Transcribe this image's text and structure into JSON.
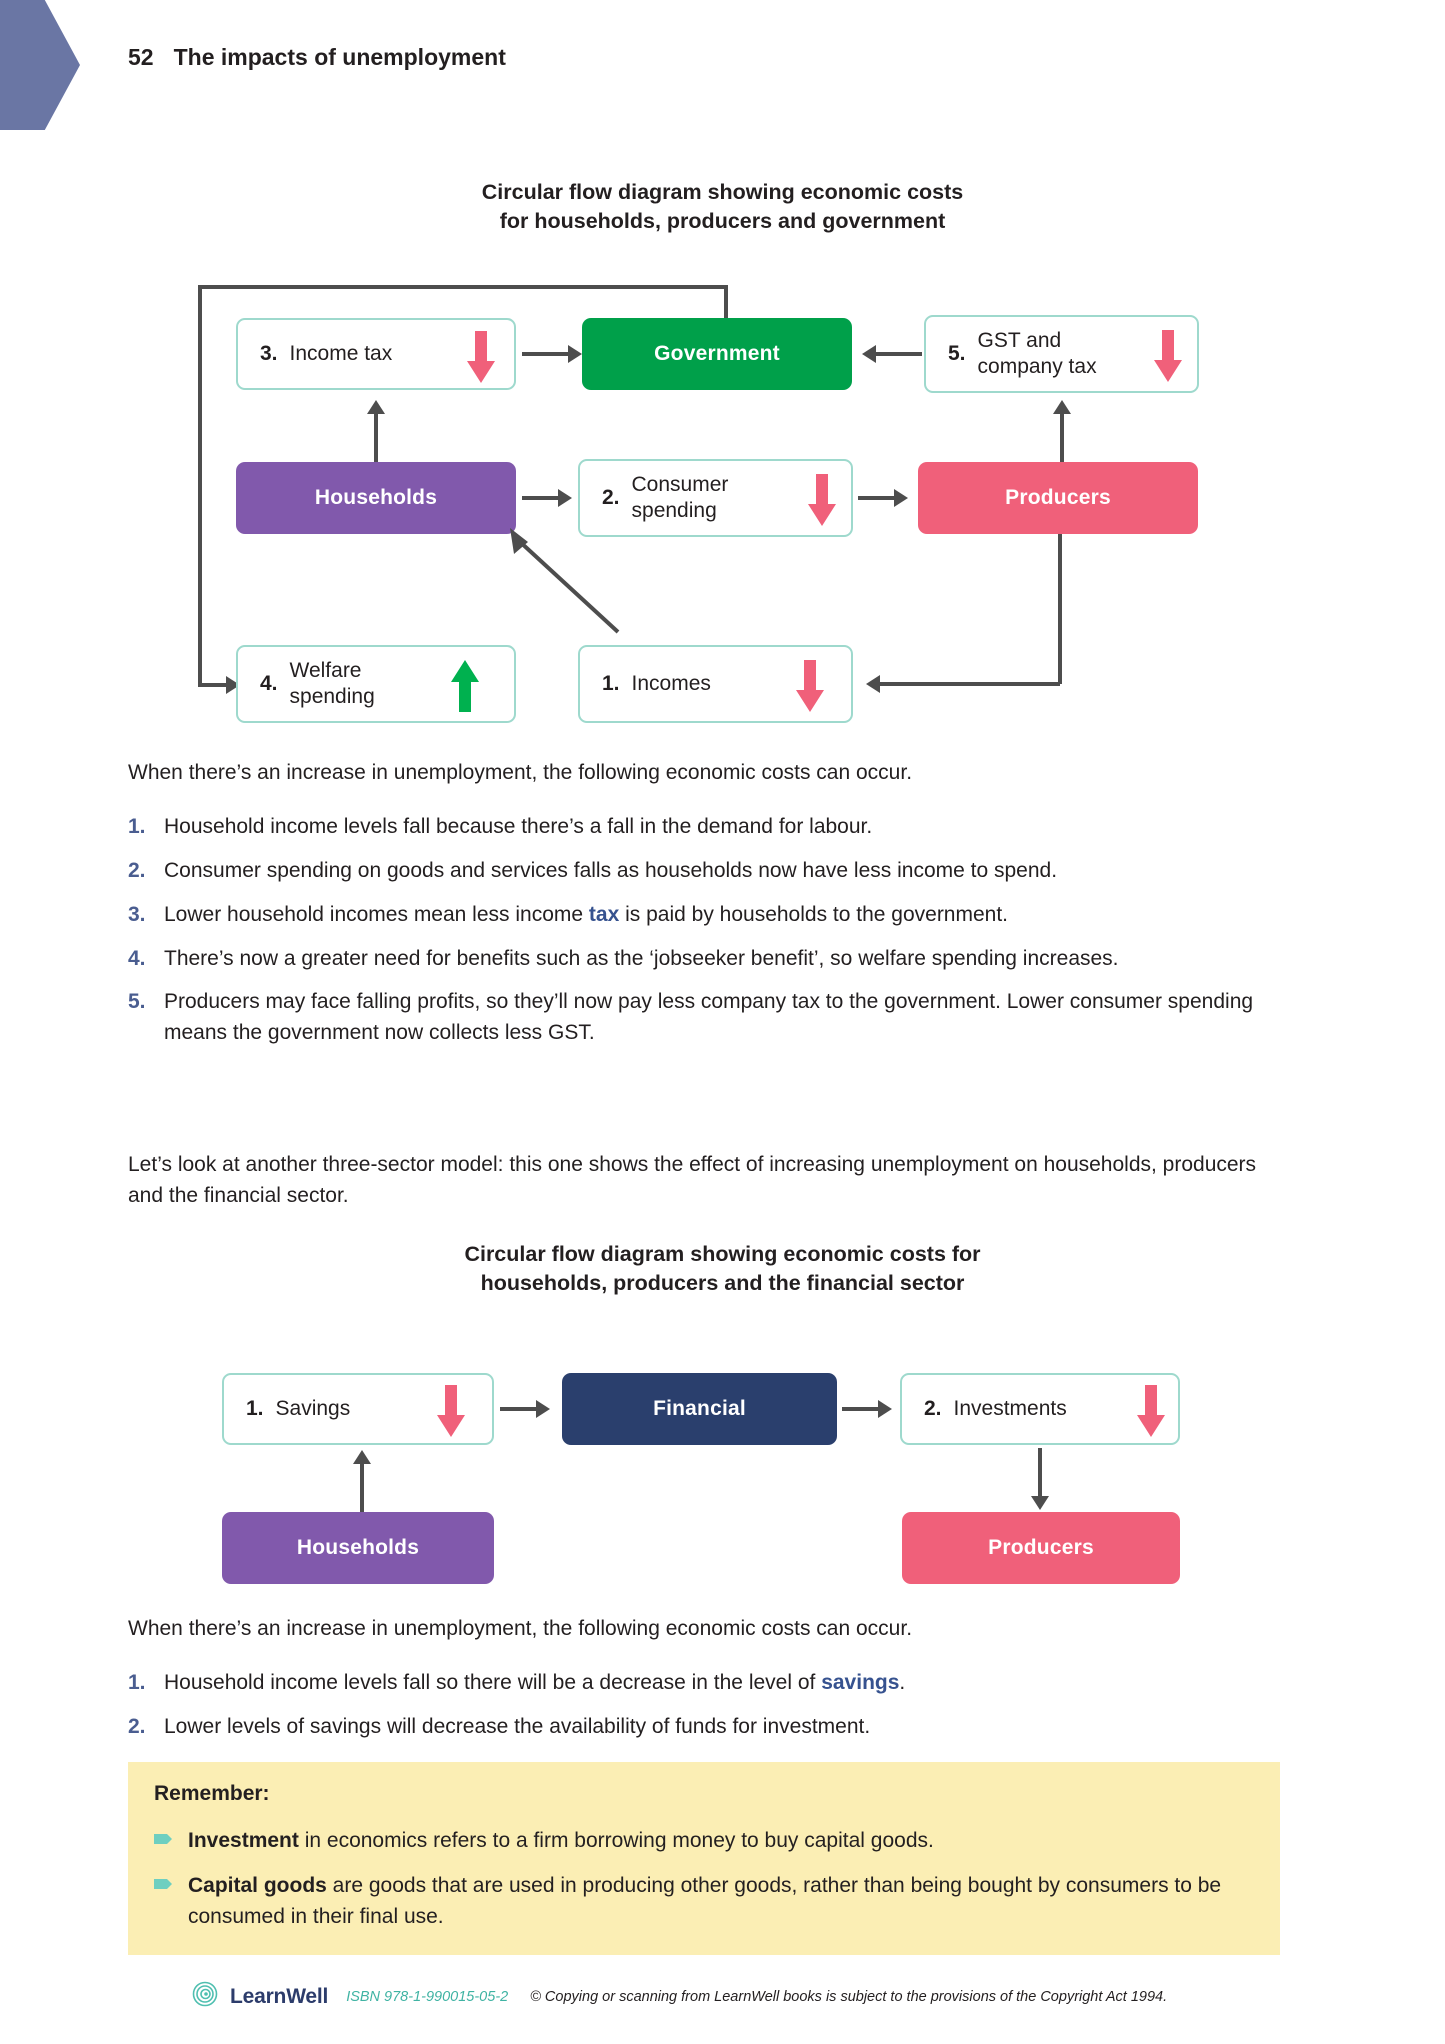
{
  "header": {
    "page_number": "52",
    "title": "The impacts of unemployment"
  },
  "diagram1": {
    "title_line1": "Circular flow diagram showing economic costs",
    "title_line2": "for households, producers and government",
    "nodes": {
      "income_tax": {
        "num": "3.",
        "label": "Income tax",
        "arrow": "down-red"
      },
      "government": {
        "label": "Government"
      },
      "gst": {
        "num": "5.",
        "label": "GST and\ncompany tax",
        "arrow": "down-red"
      },
      "households": {
        "label": "Households"
      },
      "consumer_spending": {
        "num": "2.",
        "label": "Consumer\nspending",
        "arrow": "down-red"
      },
      "producers": {
        "label": "Producers"
      },
      "welfare": {
        "num": "4.",
        "label": "Welfare\nspending",
        "arrow": "up-green"
      },
      "incomes": {
        "num": "1.",
        "label": "Incomes",
        "arrow": "down-red"
      }
    }
  },
  "intro1": "When there’s an increase in unemployment, the following economic costs can occur.",
  "list1": [
    {
      "n": "1.",
      "pre": "Household income levels fall because there’s a fall in the demand for labour.",
      "bold": "",
      "post": ""
    },
    {
      "n": "2.",
      "pre": "Consumer spending on goods and services falls as households now have less income to spend.",
      "bold": "",
      "post": ""
    },
    {
      "n": "3.",
      "pre": "Lower household incomes mean less income ",
      "bold": "tax",
      "post": " is paid by households to the government."
    },
    {
      "n": "4.",
      "pre": "There’s now a greater need for benefits such as the ‘jobseeker benefit’, so welfare spending increases.",
      "bold": "",
      "post": ""
    },
    {
      "n": "5.",
      "pre": "Producers may face falling profits, so they’ll now pay less company tax to the government. Lower consumer spending means the government now collects less GST.",
      "bold": "",
      "post": ""
    }
  ],
  "intro2": "Let’s look at another three-sector model: this one shows the effect of increasing unemployment on households, producers and the financial sector.",
  "diagram2": {
    "title_line1": "Circular flow diagram showing economic costs for",
    "title_line2": "households, producers and the financial sector",
    "nodes": {
      "savings": {
        "num": "1.",
        "label": "Savings",
        "arrow": "down-red"
      },
      "financial": {
        "label": "Financial"
      },
      "investments": {
        "num": "2.",
        "label": "Investments",
        "arrow": "down-red"
      },
      "households": {
        "label": "Households"
      },
      "producers": {
        "label": "Producers"
      }
    }
  },
  "intro3": "When there’s an increase in unemployment, the following economic costs can occur.",
  "list2": [
    {
      "n": "1.",
      "pre": "Household income levels fall so there will be a decrease in the level of ",
      "bold": "savings",
      "post": "."
    },
    {
      "n": "2.",
      "pre": "Lower levels of savings will decrease the availability of funds for investment.",
      "bold": "",
      "post": ""
    }
  ],
  "remember": {
    "title": "Remember:",
    "items": [
      {
        "bold": "Investment",
        "text": " in economics refers to a firm borrowing money to buy capital goods."
      },
      {
        "bold": "Capital goods",
        "text": " are goods that are used in producing other goods, rather than being bought by consumers to be consumed in their final use."
      }
    ]
  },
  "footer": {
    "logo_text_part1": "Learn",
    "logo_text_part2": "Well",
    "isbn": "ISBN 978-1-990015-05-2",
    "copyright": "© Copying or scanning from LearnWell books is subject to the provisions of the Copyright Act 1994."
  },
  "colors": {
    "tab": "#6a76a4",
    "government": "#00a04a",
    "households": "#8159ac",
    "producers": "#f0607a",
    "financial": "#2a3f6d",
    "outline_border": "#9ed9cd",
    "arrow_red": "#f0607a",
    "arrow_green": "#00b14f",
    "connector": "#4d4d4d",
    "list_number": "#4a5d90",
    "highlight": "#36528f",
    "remember_bg": "#fbeeb4",
    "bullet": "#6ecfc0",
    "isbn": "#3fb3a3"
  }
}
